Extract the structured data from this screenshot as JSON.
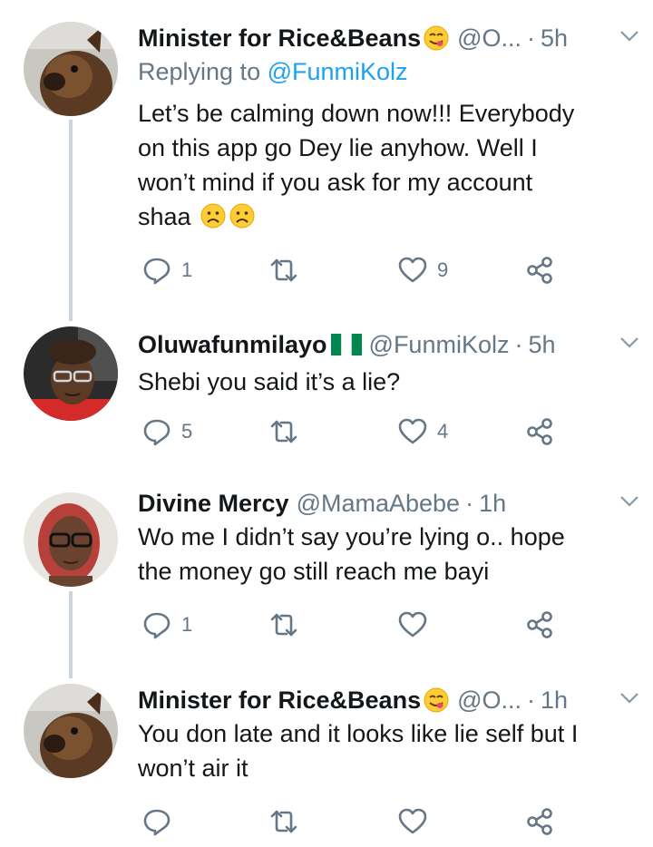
{
  "tweets": [
    {
      "name": "Minister for Rice&Beans",
      "handle": "@O...",
      "time": "5h",
      "replying_prefix": "Replying to ",
      "replying_handle": "@FunmiKolz",
      "lines": [
        "Let’s be calming down now!!! Everybody",
        "on this app go Dey lie anyhow. Well I",
        "won’t mind if you ask for my account",
        "shaa"
      ],
      "reply_count": "1",
      "retweet_count": "",
      "like_count": "9"
    },
    {
      "name": "Oluwafunmilayo",
      "handle": "@FunmiKolz",
      "time": "5h",
      "lines": [
        "Shebi you said it’s a lie?"
      ],
      "reply_count": "5",
      "retweet_count": "",
      "like_count": "4"
    },
    {
      "name": "Divine Mercy",
      "handle": "@MamaAbebe",
      "time": "1h",
      "lines": [
        "Wo me I didn’t say you’re lying o.. hope",
        "the money go still reach me bayi"
      ],
      "reply_count": "1",
      "retweet_count": "",
      "like_count": ""
    },
    {
      "name": "Minister for Rice&Beans",
      "handle": "@O...",
      "time": "1h",
      "lines": [
        "You don late and it looks like lie self but I",
        "won’t air it"
      ],
      "reply_count": "",
      "retweet_count": "",
      "like_count": ""
    }
  ],
  "separator": "·",
  "colors": {
    "text": "#14171a",
    "secondary": "#657786",
    "link": "#1da1f2",
    "thread_line": "#cdd6dd"
  },
  "icons": [
    "reply-icon",
    "retweet-icon",
    "like-icon",
    "share-icon",
    "chevron-down-icon",
    "yum-emoji-icon",
    "sad-emoji-icon",
    "nigeria-flag-icon"
  ]
}
